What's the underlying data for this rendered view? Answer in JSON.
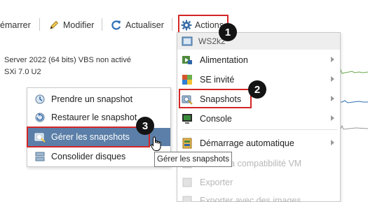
{
  "toolbar": {
    "start_label": "émarrer",
    "modify_label": "Modifier",
    "refresh_label": "Actualiser",
    "actions_label": "Actions"
  },
  "summary": {
    "os_line": "Server 2022 (64 bits) VBS non activé",
    "compat_line": "SXi 7.0 U2"
  },
  "actions_menu": {
    "header": "WS2k2",
    "items": [
      {
        "label": "Alimentation",
        "icon": "power-icon",
        "submenu": true,
        "disabled": false
      },
      {
        "label": "SE invité",
        "icon": "guest-os-icon",
        "submenu": true,
        "disabled": false
      },
      {
        "label": "Snapshots",
        "icon": "snapshot-icon",
        "submenu": true,
        "disabled": false
      },
      {
        "label": "Console",
        "icon": "console-icon",
        "submenu": true,
        "disabled": false
      },
      {
        "label": "Démarrage automatique",
        "icon": "autostart-icon",
        "submenu": true,
        "disabled": false
      },
      {
        "label": "niveau la compatibilité VM",
        "icon": "compat-icon",
        "submenu": false,
        "disabled": true
      },
      {
        "label": "Exporter",
        "icon": "export-icon",
        "submenu": false,
        "disabled": true
      },
      {
        "label": "Exporter avec des images",
        "icon": "export-images-icon",
        "submenu": false,
        "disabled": true
      }
    ]
  },
  "snapshot_menu": {
    "items": [
      {
        "label": "Prendre un snapshot",
        "icon": "take-snapshot-icon"
      },
      {
        "label": "Restaurer le snapshot",
        "icon": "restore-snapshot-icon"
      },
      {
        "label": "Gérer les snapshots",
        "icon": "manage-snapshots-icon",
        "hovered": true
      },
      {
        "label": "Consolider disques",
        "icon": "consolidate-disks-icon"
      }
    ]
  },
  "tooltip": "Gérer les snapshots",
  "badges": [
    "1",
    "2",
    "3"
  ],
  "colors": {
    "highlight_border": "#d42626",
    "hover_bg": "#5b7fa8",
    "badge_bg": "#141414",
    "disabled_text": "#b7b7b7"
  }
}
